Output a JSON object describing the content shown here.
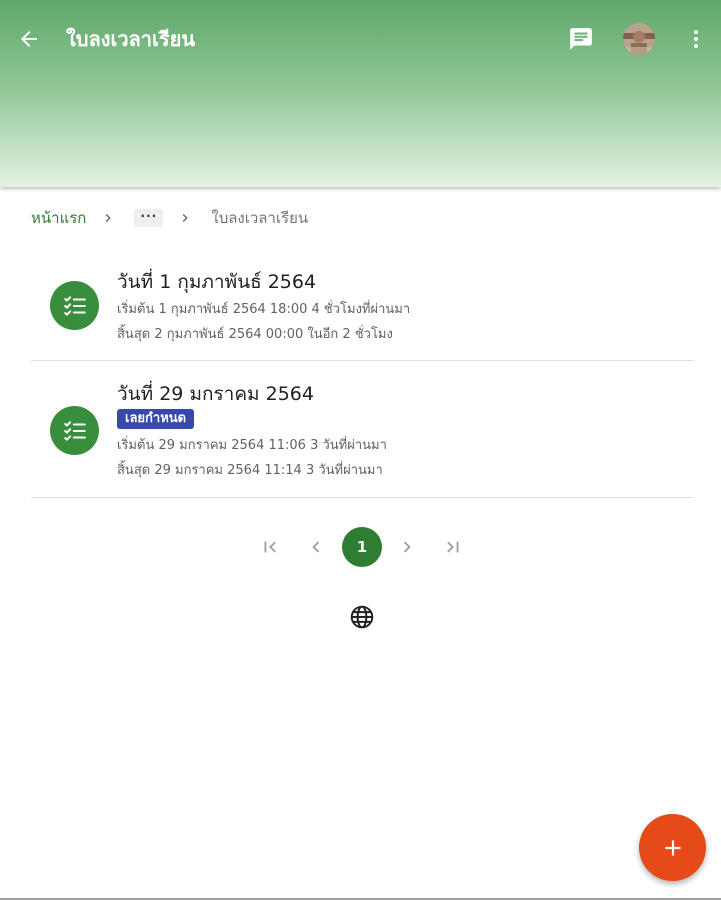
{
  "header": {
    "title": "ใบลงเวลาเรียน",
    "back_icon": "arrow-back-icon",
    "chat_icon": "message-icon",
    "avatar": "user-avatar",
    "more_icon": "more-vert-icon",
    "gradient_top": "#5fa86a",
    "gradient_bottom": "#e3f2e3"
  },
  "breadcrumb": {
    "home": "หน้าแรก",
    "ellipsis": "···",
    "current": "ใบลงเวลาเรียน"
  },
  "items": [
    {
      "title": "วันที่ 1 กุมภาพันธ์ 2564",
      "badge": null,
      "start": "เริ่มต้น 1 กุมภาพันธ์ 2564 18:00 4 ชั่วโมงที่ผ่านมา",
      "end": "สิ้นสุด 2 กุมภาพันธ์ 2564 00:00 ในอีก 2 ชั่วโมง",
      "icon": "checklist-icon"
    },
    {
      "title": "วันที่ 29 มกราคม 2564",
      "badge": "เลยกำหนด",
      "start": "เริ่มต้น 29 มกราคม 2564 11:06 3 วันที่ผ่านมา",
      "end": "สิ้นสุด 29 มกราคม 2564 11:14 3 วันที่ผ่านมา",
      "icon": "checklist-icon"
    }
  ],
  "pagination": {
    "current_page": "1",
    "first_icon": "first-page-icon",
    "prev_icon": "chevron-left-icon",
    "next_icon": "chevron-right-icon",
    "last_icon": "last-page-icon"
  },
  "language_icon": "globe-icon",
  "fab_icon": "plus-icon",
  "colors": {
    "accent": "#2e7d32",
    "item_icon_bg": "#388e3c",
    "badge_bg": "#3949ab",
    "fab_bg": "#e64a19"
  }
}
